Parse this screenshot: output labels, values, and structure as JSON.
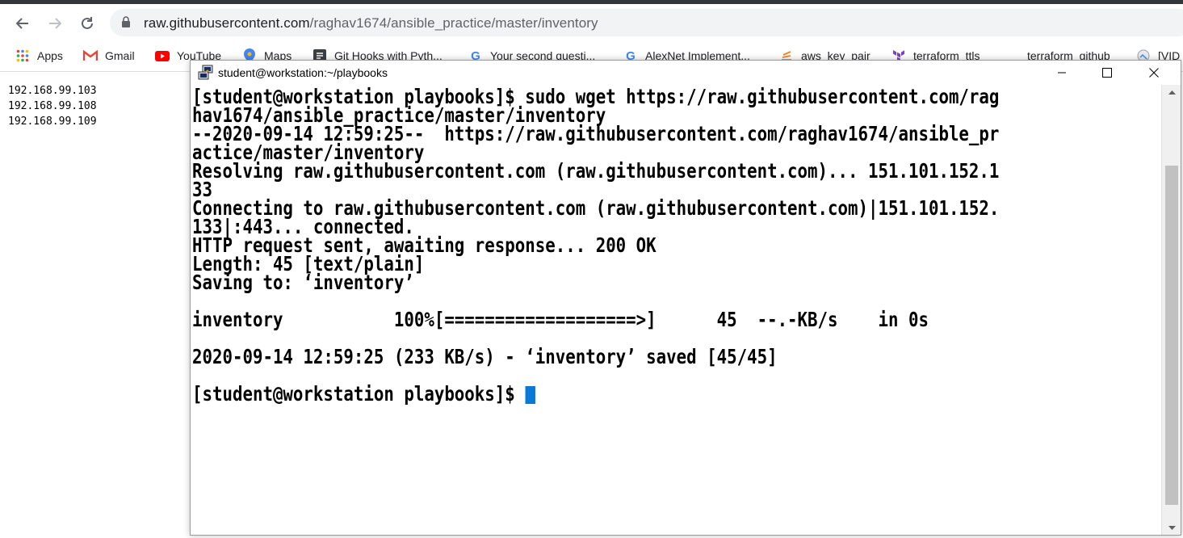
{
  "browser": {
    "url_host": "raw.githubusercontent.com",
    "url_path": "/raghav1674/ansible_practice/master/inventory",
    "nav": [
      {
        "name": "back",
        "icon": "arrow-left-icon"
      },
      {
        "name": "forward",
        "icon": "arrow-right-icon"
      },
      {
        "name": "reload",
        "icon": "reload-icon"
      }
    ],
    "bookmarks": [
      {
        "label": "Apps",
        "icon": "apps-grid-icon"
      },
      {
        "label": "Gmail",
        "icon": "gmail-icon"
      },
      {
        "label": "YouTube",
        "icon": "youtube-icon"
      },
      {
        "label": "Maps",
        "icon": "maps-icon"
      },
      {
        "label": "Git Hooks with Pyth...",
        "icon": "bookmark-page-icon"
      },
      {
        "label": "Your second questi...",
        "icon": "google-icon"
      },
      {
        "label": "AlexNet Implement...",
        "icon": "google-icon"
      },
      {
        "label": "aws_key_pair",
        "icon": "bookmark-stack-icon"
      },
      {
        "label": "terraform_ttls",
        "icon": "terraform-icon"
      },
      {
        "label": "terraform_github",
        "icon": ""
      },
      {
        "label": "[VID",
        "icon": "bookmark-image-icon"
      }
    ]
  },
  "page": {
    "lines": [
      "192.168.99.103",
      "192.168.99.108",
      "192.168.99.109"
    ]
  },
  "putty": {
    "title": "student@workstation:~/playbooks",
    "terminal_lines": [
      "[student@workstation playbooks]$ sudo wget https://raw.githubusercontent.com/rag",
      "hav1674/ansible_practice/master/inventory",
      "--2020-09-14 12:59:25--  https://raw.githubusercontent.com/raghav1674/ansible_pr",
      "actice/master/inventory",
      "Resolving raw.githubusercontent.com (raw.githubusercontent.com)... 151.101.152.1",
      "33",
      "Connecting to raw.githubusercontent.com (raw.githubusercontent.com)|151.101.152.",
      "133|:443... connected.",
      "HTTP request sent, awaiting response... 200 OK",
      "Length: 45 [text/plain]",
      "Saving to: ‘inventory’",
      "",
      "inventory           100%[===================>]      45  --.-KB/s    in 0s",
      "",
      "2020-09-14 12:59:25 (233 KB/s) - ‘inventory’ saved [45/45]",
      "",
      "[student@workstation playbooks]$ "
    ],
    "cursor_color": "#0a78d7"
  }
}
